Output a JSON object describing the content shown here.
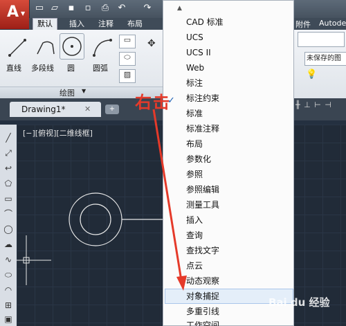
{
  "quick_access": {
    "icons": [
      "new-icon",
      "open-icon",
      "save-icon",
      "save-as-icon",
      "print-icon",
      "undo-icon",
      "redo-icon"
    ]
  },
  "ribbon": {
    "tabs": [
      "默认",
      "插入",
      "注释",
      "布局"
    ],
    "active_tab": "默认",
    "tools": {
      "line": "直线",
      "polyline": "多段线",
      "circle": "圆",
      "arc": "圆弧"
    },
    "panel_title": "绘图"
  },
  "drawing_tab": {
    "label": "Drawing1*"
  },
  "viewport_label": "[−][俯视][二维线框]",
  "menu": {
    "items": [
      "CAD 标准",
      "UCS",
      "UCS II",
      "Web",
      "标注",
      "标注约束",
      "标准",
      "标准注释",
      "布局",
      "参数化",
      "参照",
      "参照编辑",
      "测量工具",
      "插入",
      "查询",
      "查找文字",
      "点云",
      "动态观察",
      "对象捕捉",
      "多重引线",
      "工作空间"
    ],
    "checked_index": 4,
    "highlighted_index": 18
  },
  "right_panel": {
    "tab1": "附件",
    "tab2": "Autode",
    "unsaved_label": "未保存的图"
  },
  "annotation": {
    "text": "右击",
    "color": "#e53a2a"
  },
  "watermark": {
    "text": "Bai du 经验"
  }
}
